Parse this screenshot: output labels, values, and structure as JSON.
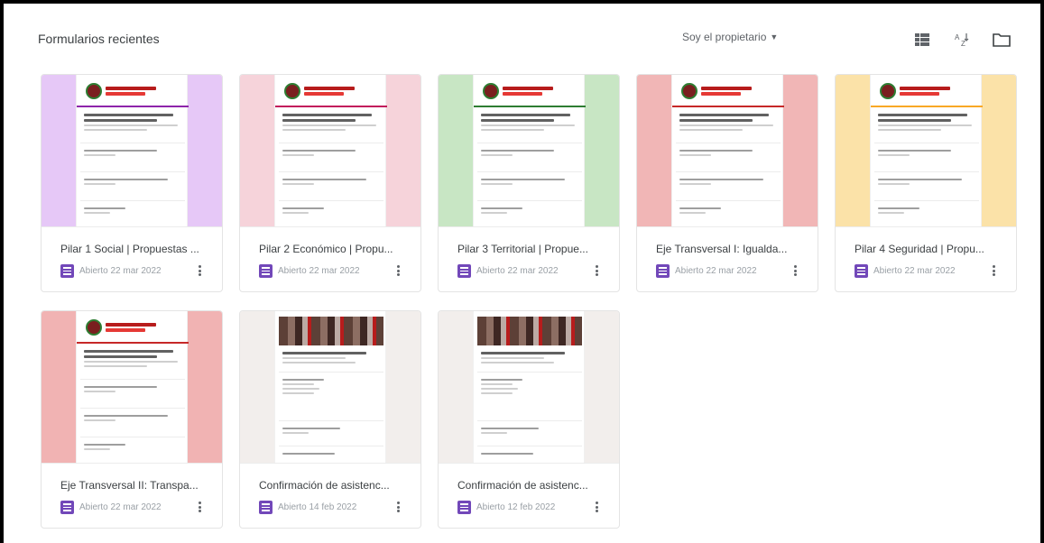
{
  "header": {
    "title": "Formularios recientes",
    "owner_filter": "Soy el propietario",
    "icons": [
      "list-view-icon",
      "sort-az-icon",
      "folder-icon"
    ]
  },
  "forms": [
    {
      "name": "Pilar 1 Social | Propuestas ...",
      "opened": "Abierto 22 mar 2022",
      "theme_color": "#e6c8f7",
      "accent": "#8e24aa"
    },
    {
      "name": "Pilar 2 Económico | Propu...",
      "opened": "Abierto 22 mar 2022",
      "theme_color": "#f6d3da",
      "accent": "#c2185b"
    },
    {
      "name": "Pilar 3 Territorial | Propue...",
      "opened": "Abierto 22 mar 2022",
      "theme_color": "#c8e6c4",
      "accent": "#2e7d32"
    },
    {
      "name": "Eje Transversal I: Igualda...",
      "opened": "Abierto 22 mar 2022",
      "theme_color": "#f1b6b6",
      "accent": "#c62828"
    },
    {
      "name": "Pilar 4 Seguridad | Propu...",
      "opened": "Abierto 22 mar 2022",
      "theme_color": "#fbe2a8",
      "accent": "#f9a825"
    },
    {
      "name": "Eje Transversal II: Transpa...",
      "opened": "Abierto 22 mar 2022",
      "theme_color": "#f1b3b3",
      "accent": "#c62828"
    },
    {
      "name": "Confirmación de asistenc...",
      "opened": "Abierto 14 feb 2022",
      "theme_color": "#f2eeec",
      "accent": "#9e9e9e"
    },
    {
      "name": "Confirmación de asistenc...",
      "opened": "Abierto 12 feb 2022",
      "theme_color": "#f2eeec",
      "accent": "#9e9e9e"
    }
  ]
}
